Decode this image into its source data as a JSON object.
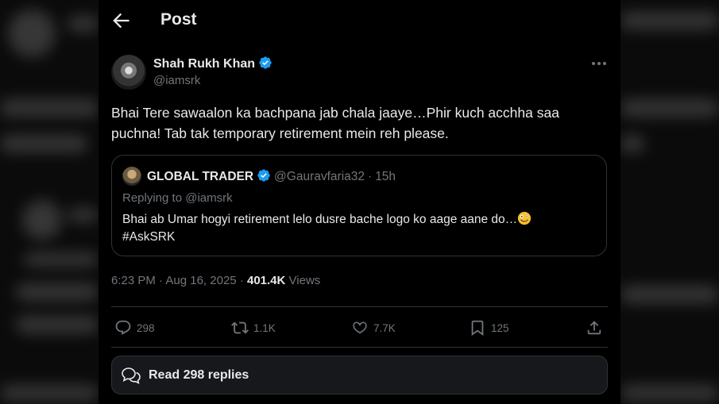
{
  "header": {
    "title": "Post"
  },
  "tweet": {
    "author_name": "Shah Rukh Khan",
    "author_handle": "@iamsrk",
    "text": "Bhai Tere sawaalon ka bachpana jab chala jaaye…Phir kuch acchha saa\npuchna! Tab tak temporary retirement mein reh please.",
    "time": "6:23 PM",
    "date": "Aug 16, 2025",
    "views_count": "401.4K",
    "views_label": "Views"
  },
  "quote": {
    "author_name": "GLOBAL TRADER",
    "author_handle": "@Gauravfaria32",
    "age": "15h",
    "replying_to": "Replying to @iamsrk",
    "text": "Bhai ab Umar hogyi retirement lelo dusre bache logo ko aage aane do…",
    "hashtag": "#AskSRK"
  },
  "actions": {
    "replies": "298",
    "reposts": "1.1K",
    "likes": "7.7K",
    "bookmarks": "125"
  },
  "read_replies_label": "Read 298 replies",
  "icons": [
    "back-arrow-icon",
    "verified-badge-icon",
    "more-icon",
    "zany-face-emoji-icon",
    "reply-icon",
    "repost-icon",
    "like-icon",
    "bookmark-icon",
    "share-icon",
    "speech-bubbles-icon"
  ],
  "colors": {
    "background": "#000000",
    "text": "#e7e9ea",
    "muted": "#71767b",
    "verified": "#1d9bf0",
    "border": "#2f3336"
  }
}
